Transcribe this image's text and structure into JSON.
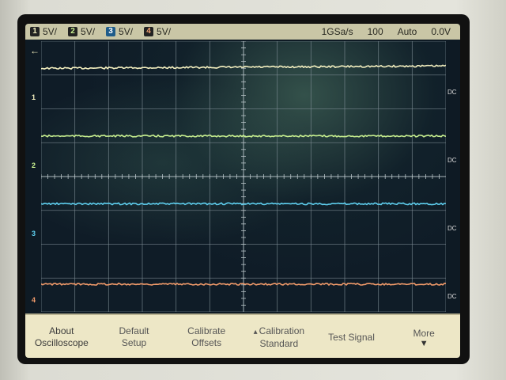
{
  "status": {
    "channels": [
      {
        "num": "1",
        "scale": "5V/",
        "color": "#f4f0c0"
      },
      {
        "num": "2",
        "scale": "5V/",
        "color": "#c8f090"
      },
      {
        "num": "3",
        "scale": "5V/",
        "color": "#5fd0f0"
      },
      {
        "num": "4",
        "scale": "5V/",
        "color": "#f0a070"
      }
    ],
    "sample_rate": "1GSa/s",
    "timebase": "100",
    "trigger_mode": "Auto",
    "trigger_level": "0.0V"
  },
  "traces": [
    {
      "channel": "1",
      "label": "1",
      "coupling": "DC",
      "color": "#f4f0c0",
      "level": 0.04
    },
    {
      "channel": "2",
      "label": "2",
      "coupling": "DC",
      "color": "#c8f090",
      "level": 0.04
    },
    {
      "channel": "3",
      "label": "3",
      "coupling": "DC",
      "color": "#5fd0f0",
      "level": 0.03
    },
    {
      "channel": "4",
      "label": "4",
      "coupling": "DC",
      "color": "#f09a6a",
      "level": 0.03
    }
  ],
  "softkeys": [
    {
      "line1": "About",
      "line2": "Oscilloscope"
    },
    {
      "line1": "Default",
      "line2": "Setup"
    },
    {
      "line1": "Calibrate",
      "line2": "Offsets"
    },
    {
      "line1": "Calibration",
      "line2": "Standard"
    },
    {
      "line1": "Test Signal",
      "line2": ""
    },
    {
      "line1": "More",
      "line2": ""
    }
  ],
  "icons": {
    "back": "left-arrow-icon",
    "more": "down-arrow-icon",
    "calib": "up-arrow-icon"
  }
}
